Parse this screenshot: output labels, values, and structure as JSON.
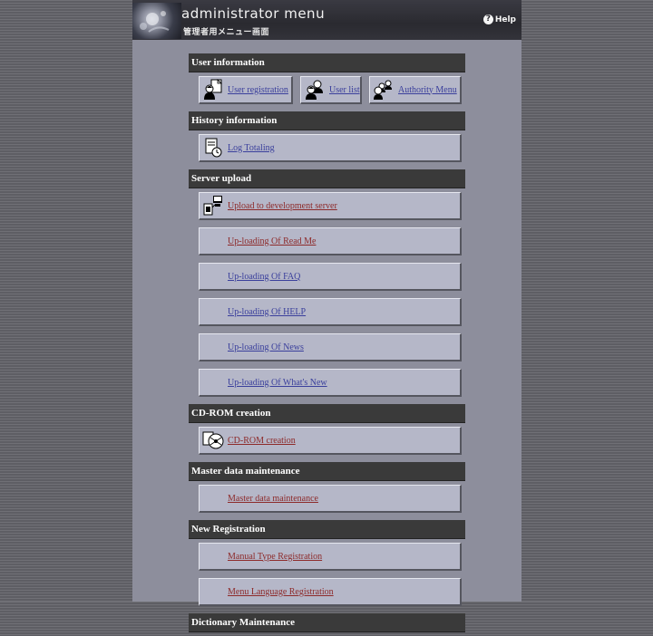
{
  "header": {
    "title_en": "administrator menu",
    "title_ja": "管理者用メニュー画面",
    "help_label": "Help"
  },
  "sections": {
    "user_info": {
      "title": "User information",
      "items": {
        "user_registration": "User registration",
        "user_list": "User list",
        "authority_menu": "Authority Menu"
      }
    },
    "history": {
      "title": "History information",
      "log_totaling": "Log Totaling"
    },
    "server_upload": {
      "title": "Server upload",
      "upload_dev": "Upload to development server",
      "readme": "Up-loading Of Read Me",
      "faq": "Up-loading Of FAQ",
      "help": "Up-loading Of HELP",
      "news": "Up-loading Of News",
      "whats_new": "Up-loading Of What's New"
    },
    "cdrom": {
      "title": "CD-ROM creation",
      "item": "CD-ROM creation"
    },
    "master": {
      "title": "Master data maintenance",
      "item": "Master data maintenance"
    },
    "new_reg": {
      "title": "New Registration",
      "manual_type": "Manual Type Registration",
      "menu_language": "Menu Language Registration"
    },
    "dictionary": {
      "title": "Dictionary Maintenance"
    }
  },
  "colors": {
    "link_visited": "#3a3f9c",
    "link_unvisited": "#8d2a2a",
    "section_bg": "#3a3a3a",
    "item_bg": "#b5b7c8"
  },
  "icons": {
    "user_registration": "user-add-icon",
    "user_list": "users-icon",
    "authority_menu": "authority-icon",
    "log_totaling": "log-document-icon",
    "upload_dev": "server-upload-icon",
    "cdrom": "cd-rom-icon"
  }
}
